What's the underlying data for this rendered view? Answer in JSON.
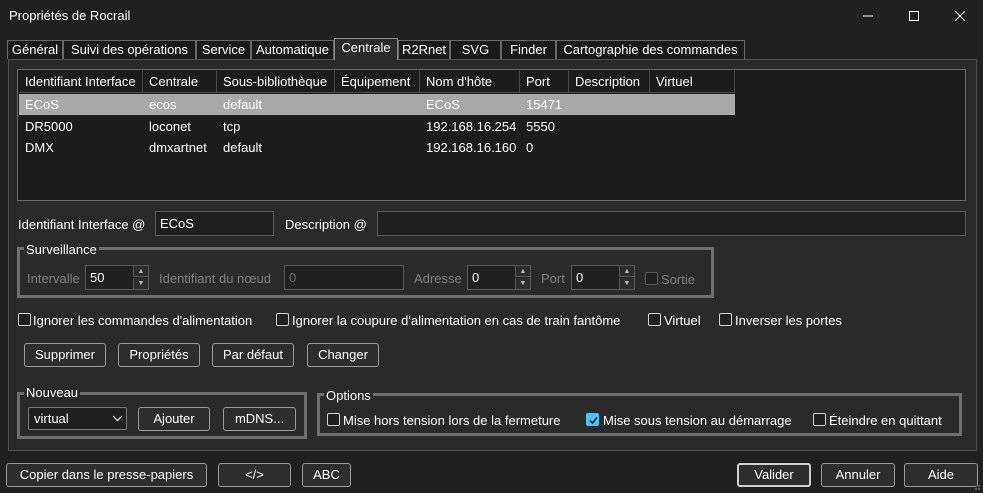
{
  "window": {
    "title": "Propriétés de Rocrail",
    "minimize_label": "–",
    "maximize_label": "□",
    "close_label": "✕"
  },
  "tabs": [
    {
      "label": "Général"
    },
    {
      "label": "Suivi des opérations"
    },
    {
      "label": "Service"
    },
    {
      "label": "Automatique"
    },
    {
      "label": "Centrale",
      "active": true
    },
    {
      "label": "R2Rnet"
    },
    {
      "label": "SVG"
    },
    {
      "label": "Finder"
    },
    {
      "label": "Cartographie des commandes"
    }
  ],
  "table": {
    "columns": [
      "Identifiant Interface",
      "Centrale",
      "Sous-bibliothèque",
      "Équipement",
      "Nom d'hôte",
      "Port",
      "Description",
      "Virtuel"
    ],
    "rows": [
      {
        "id": "ECoS",
        "centrale": "ecos",
        "sublib": "default",
        "equip": "",
        "host": "ECoS",
        "port": "15471",
        "desc": "",
        "virtuel": "",
        "selected": true
      },
      {
        "id": "DR5000",
        "centrale": "loconet",
        "sublib": "tcp",
        "equip": "",
        "host": "192.168.16.254",
        "port": "5550",
        "desc": "",
        "virtuel": ""
      },
      {
        "id": "DMX",
        "centrale": "dmxartnet",
        "sublib": "default",
        "equip": "",
        "host": "192.168.16.160",
        "port": "0",
        "desc": "",
        "virtuel": ""
      }
    ]
  },
  "form": {
    "id_label": "Identifiant Interface @",
    "id_value": "ECoS",
    "desc_label": "Description @",
    "desc_value": ""
  },
  "surveillance": {
    "title": "Surveillance",
    "interval_label": "Intervalle",
    "interval_value": "50",
    "node_label": "Identifiant du nœud",
    "node_value": "0",
    "address_label": "Adresse",
    "address_value": "0",
    "port_label": "Port",
    "port_value": "0",
    "output_label": "Sortie"
  },
  "checkboxes": {
    "ignore_power": "Ignorer les commandes d'alimentation",
    "ignore_shortcut": "Ignorer la coupure d'alimentation en cas de train fantôme",
    "virtual": "Virtuel",
    "invert_ports": "Inverser les portes"
  },
  "actions": {
    "delete": "Supprimer",
    "properties": "Propriétés",
    "default": "Par défaut",
    "change": "Changer"
  },
  "nouveau": {
    "title": "Nouveau",
    "select_value": "virtual",
    "add": "Ajouter",
    "mdns": "mDNS..."
  },
  "options": {
    "title": "Options",
    "power_off_close": "Mise hors tension lors de la fermeture",
    "power_on_start": "Mise sous tension au démarrage",
    "power_on_start_checked": true,
    "shutdown_quit": "Éteindre en quittant"
  },
  "footer": {
    "copy": "Copier dans le presse-papiers",
    "xml": "</>",
    "abc": "ABC",
    "ok": "Valider",
    "cancel": "Annuler",
    "help": "Aide"
  },
  "colors": {
    "background": "#202020",
    "panel": "#2a2a2a",
    "selected_row": "#a8a8a8",
    "accent_check": "#4cc2ff"
  }
}
